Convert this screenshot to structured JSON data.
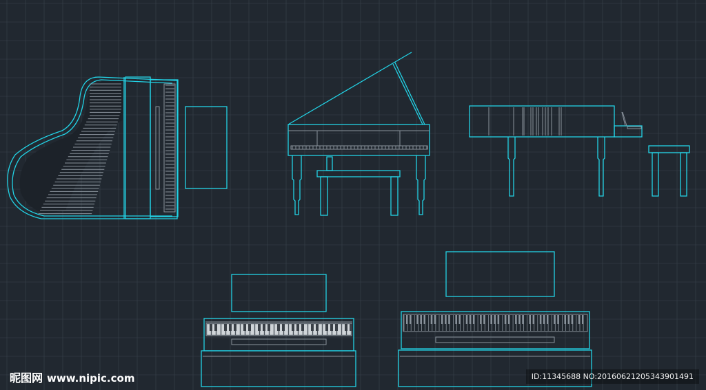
{
  "watermark": {
    "logo_text": "昵图网",
    "site": "www.nipic.com",
    "id_text": "ID:11345688 NO:20160621205343901491"
  },
  "colors": {
    "background": "#212830",
    "grid": "#3a434d",
    "outline": "#22d3e6",
    "detail": "#8a939c"
  }
}
